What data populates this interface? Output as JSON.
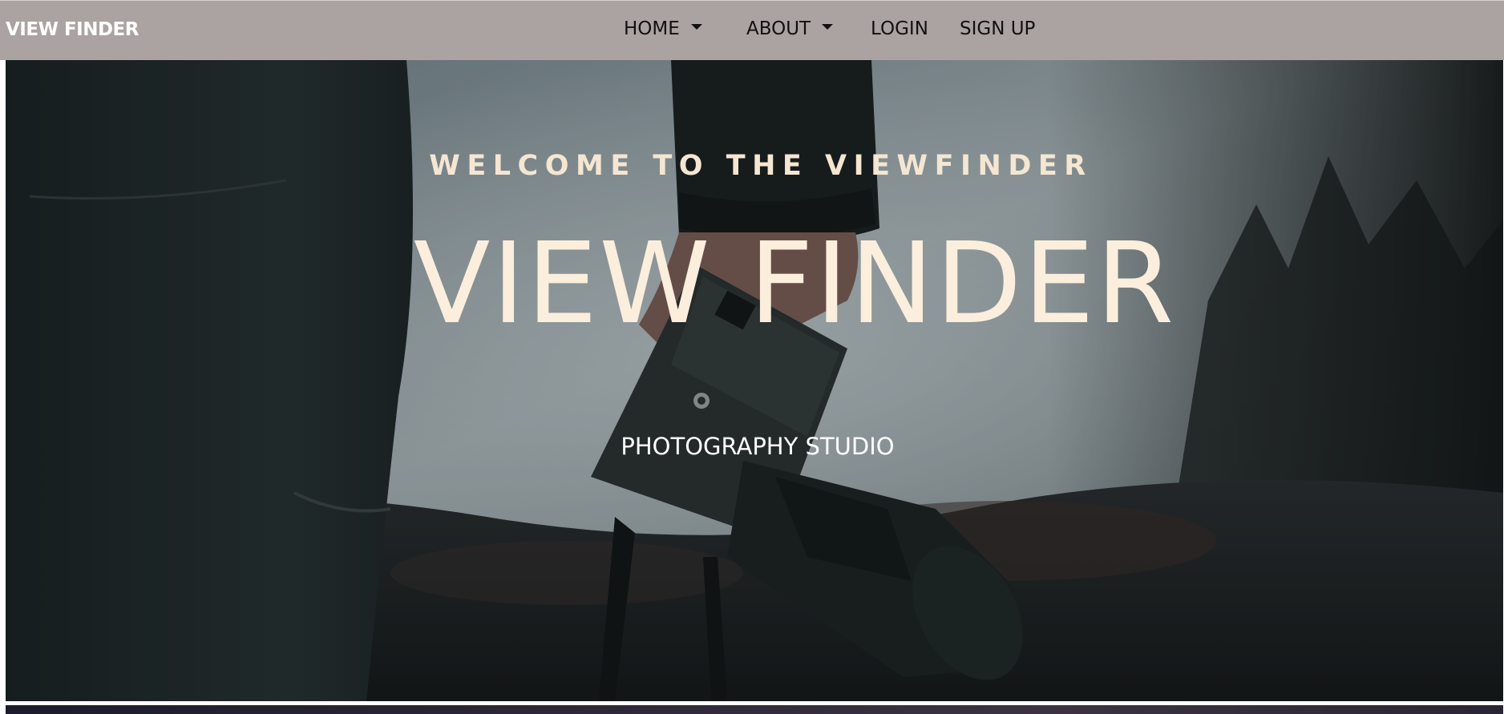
{
  "navbar": {
    "brand": "VIEW FINDER",
    "items": [
      {
        "label": "HOME",
        "dropdown": true
      },
      {
        "label": "ABOUT",
        "dropdown": true
      },
      {
        "label": "LOGIN",
        "dropdown": false
      },
      {
        "label": "SIGN UP",
        "dropdown": false
      }
    ]
  },
  "hero": {
    "welcome": "WELCOME TO THE VIEWFINDER",
    "title": "VIEW FINDER",
    "subtitle": "PHOTOGRAPHY STUDIO"
  },
  "colors": {
    "navbar_bg": "#aba3a1",
    "hero_text": "#fbeedc",
    "accent_cream": "#f5e6d2"
  }
}
